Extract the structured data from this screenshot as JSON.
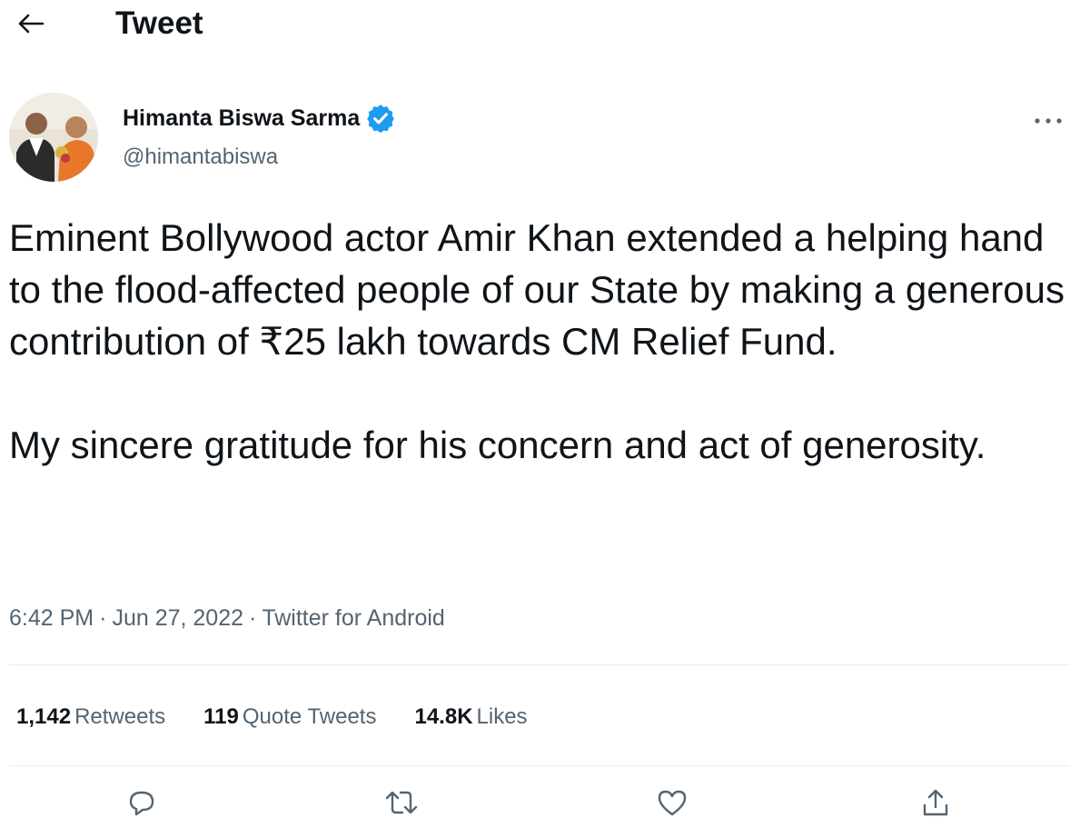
{
  "header": {
    "title": "Tweet",
    "back_icon": "arrow-left-icon"
  },
  "author": {
    "name": "Himanta Biswa Sarma",
    "handle": "@himantabiswa",
    "verified": true,
    "verified_color": "#1d9bf0"
  },
  "tweet": {
    "paragraphs": [
      "Eminent Bollywood actor Amir Khan extended a helping hand to the flood-affected people of our State by making a generous contribution of ₹25 lakh towards CM Relief Fund.",
      "My sincere gratitude for his concern and act of generosity."
    ],
    "time": "6:42 PM",
    "date": "Jun 27, 2022",
    "source": "Twitter for Android"
  },
  "stats": {
    "retweets": {
      "count": "1,142",
      "label": "Retweets"
    },
    "quote_tweets": {
      "count": "119",
      "label": "Quote Tweets"
    },
    "likes": {
      "count": "14.8K",
      "label": "Likes"
    }
  },
  "actions": [
    "reply-icon",
    "retweet-icon",
    "like-icon",
    "share-icon"
  ],
  "colors": {
    "text": "#0f1419",
    "secondary": "#536471",
    "divider": "#e6ecf0"
  }
}
